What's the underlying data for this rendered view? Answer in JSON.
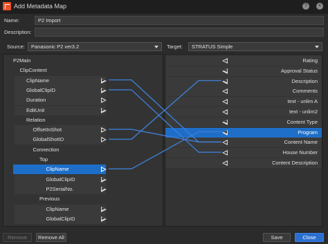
{
  "window": {
    "title": "Add Metadata Map"
  },
  "form": {
    "name_label": "Name:",
    "name_value": "P2 Import",
    "description_label": "Description:",
    "description_value": ""
  },
  "source": {
    "label": "Source:",
    "value": "Panasonic P2 ver3.2"
  },
  "target": {
    "label": "Target:",
    "value": "STRATUS Simple"
  },
  "source_tree": [
    {
      "label": "P2Main",
      "indent": 0,
      "arrow": false
    },
    {
      "label": "ClipContent",
      "indent": 1,
      "arrow": false
    },
    {
      "label": "ClipName",
      "indent": 2,
      "arrow": true
    },
    {
      "label": "GlobalClipID",
      "indent": 2,
      "arrow": true
    },
    {
      "label": "Duration",
      "indent": 2,
      "arrow": true
    },
    {
      "label": "EditUnit",
      "indent": 2,
      "arrow": true
    },
    {
      "label": "Relation",
      "indent": 2,
      "arrow": false
    },
    {
      "label": "OffsetInShot",
      "indent": 3,
      "arrow": true
    },
    {
      "label": "GlobalShotID",
      "indent": 3,
      "arrow": true
    },
    {
      "label": "Connection",
      "indent": 3,
      "arrow": false
    },
    {
      "label": "Top",
      "indent": 4,
      "arrow": false
    },
    {
      "label": "ClipName",
      "indent": 5,
      "arrow": true,
      "selected": true
    },
    {
      "label": "GlobalClipID",
      "indent": 5,
      "arrow": true
    },
    {
      "label": "P2SerialNo.",
      "indent": 5,
      "arrow": true
    },
    {
      "label": "Previous",
      "indent": 4,
      "arrow": false
    },
    {
      "label": "ClipName",
      "indent": 5,
      "arrow": true
    },
    {
      "label": "GlobalClipID",
      "indent": 5,
      "arrow": true
    }
  ],
  "target_fields": [
    {
      "label": "Rating"
    },
    {
      "label": "Approval Status"
    },
    {
      "label": "Description"
    },
    {
      "label": "Comments"
    },
    {
      "label": "text - unlim A"
    },
    {
      "label": "text - unlim2"
    },
    {
      "label": "Content Type"
    },
    {
      "label": "Program",
      "selected": true
    },
    {
      "label": "Content Name"
    },
    {
      "label": "House Number"
    },
    {
      "label": "Content Description"
    }
  ],
  "mappings": [
    {
      "source": 2,
      "target": 8
    },
    {
      "source": 3,
      "target": 9
    },
    {
      "source": 8,
      "target": 2
    },
    {
      "source": 7,
      "target": 8
    },
    {
      "source": 11,
      "target": 7
    }
  ],
  "buttons": {
    "remove": "Remove",
    "remove_all": "Remove All",
    "save": "Save",
    "close": "Close"
  },
  "colors": {
    "selection": "#1e6ec8",
    "connector": "#3d7fd4",
    "close_button": "#2a6fd0"
  },
  "icons": {
    "app": "app-logo-icon",
    "help": "help-icon",
    "close": "close-icon"
  }
}
